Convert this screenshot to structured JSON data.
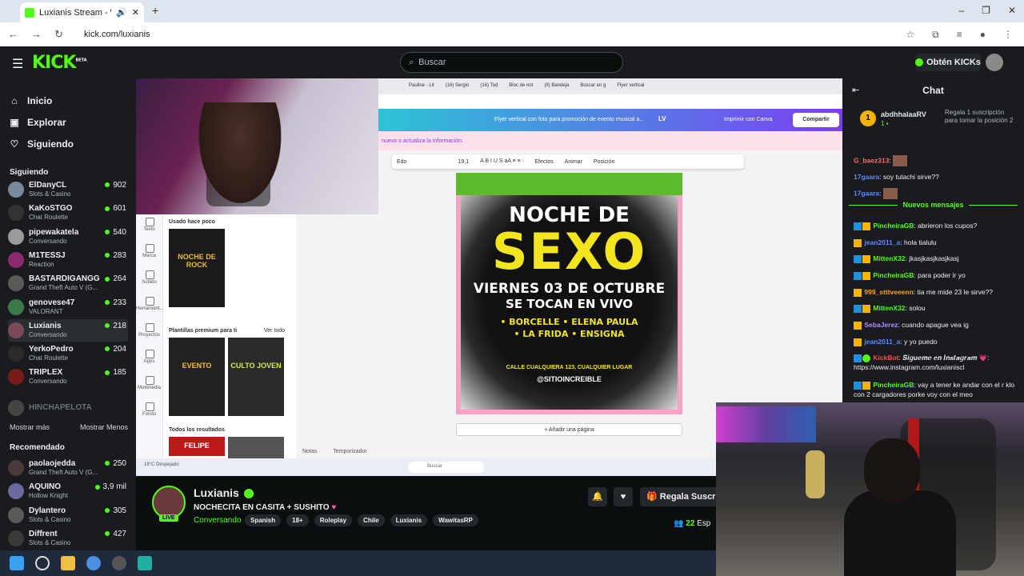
{
  "browser": {
    "tab_title": "Luxianis Stream - Watch Liv",
    "url": "kick.com/luxianis"
  },
  "header": {
    "logo": "KICK",
    "logo_beta": "BETA",
    "search_placeholder": "Buscar",
    "get_kicks": "Obtén KICKs"
  },
  "sidebar": {
    "nav": [
      {
        "label": "Inicio",
        "icon": "home-icon"
      },
      {
        "label": "Explorar",
        "icon": "compass-icon"
      },
      {
        "label": "Siguiendo",
        "icon": "heart-icon"
      }
    ],
    "following_title": "Siguiendo",
    "following": [
      {
        "name": "ElDanyCL",
        "category": "Slots & Casino",
        "viewers": "902",
        "color": "#7a8a9a"
      },
      {
        "name": "KaKoSTGO",
        "category": "Chat Roulette",
        "viewers": "601",
        "color": "#333333"
      },
      {
        "name": "pipewakatela",
        "category": "Conversando",
        "viewers": "540",
        "color": "#9a9a9a"
      },
      {
        "name": "M1TESSJ",
        "category": "Reaction",
        "viewers": "283",
        "color": "#8a2a6a"
      },
      {
        "name": "BASTARDIGANGG",
        "category": "Grand Theft Auto V (G...",
        "viewers": "264",
        "color": "#5a5a5a"
      },
      {
        "name": "genovese47",
        "category": "VALORANT",
        "viewers": "233",
        "color": "#3a7a4a"
      },
      {
        "name": "Luxianis",
        "category": "Conversando",
        "viewers": "218",
        "color": "#7a4a5a"
      },
      {
        "name": "YerkoPedro",
        "category": "Chat Roulette",
        "viewers": "204",
        "color": "#2a2a2a"
      },
      {
        "name": "TRIPLEX",
        "category": "Conversando",
        "viewers": "185",
        "color": "#7a1a1a"
      }
    ],
    "offline": "HINCHAPELOTA",
    "show_more": "Mostrar más",
    "show_less": "Mostrar Menos",
    "recommended_title": "Recomendado",
    "recommended": [
      {
        "name": "paolaojedda",
        "category": "Grand Theft Auto V (G...",
        "viewers": "250",
        "color": "#4a3a3a"
      },
      {
        "name": "AQUINO",
        "category": "Hollow Knight",
        "viewers": "3,9 mil",
        "color": "#6a6aa0"
      },
      {
        "name": "Dylantero",
        "category": "Slots & Casino",
        "viewers": "305",
        "color": "#5a5a5a"
      },
      {
        "name": "Diffrent",
        "category": "Slots & Casino",
        "viewers": "427",
        "color": "#3a3a3a"
      }
    ]
  },
  "video": {
    "canva_tabs": [
      "Pauline - Lit",
      "(16) Sergio",
      "(16) Tod",
      "Bloc de not",
      "(9) Bandeja",
      "Buscar en g",
      "Flyer vertical"
    ],
    "canva_title": "Flyer vertical con foto para promoción de evento musical a...",
    "canva_lv": "LV",
    "canva_print": "Imprimir con Canva",
    "canva_share": "Compartir",
    "canva_notice": "nuevo o actualiza la información.",
    "toolbar_font": "Edo",
    "toolbar_size": "19,1",
    "toolbar_effects": "Efectos",
    "toolbar_animate": "Animar",
    "toolbar_position": "Posición",
    "panel_recent": "Usado hace poco",
    "panel_premium": "Plantillas premium para ti",
    "panel_see_all": "Ver todo",
    "panel_all_results": "Todos los resultados",
    "side_icons": [
      "Texto",
      "Marca",
      "Subido",
      "Herramient...",
      "Proyectos",
      "Apps",
      "Multimedia",
      "Fondo"
    ],
    "thumb1": "NOCHE DE ROCK",
    "thumb2": "EVENTO",
    "thumb3": "CULTO JOVEN",
    "thumb4": "FELIPE",
    "poster_line1": "NOCHE DE",
    "poster_line2": "SEXO",
    "poster_line3": "VIERNES 03 DE OCTUBRE",
    "poster_line4": "SE TOCAN EN VIVO",
    "poster_line5": "• BORCELLE • ELENA PAULA",
    "poster_line6": "• LA FRIDA • ENSIGNA",
    "poster_line7": "CALLE CUALQUIERA 123, CUALQUIER LUGAR",
    "poster_line8": "@SITIOINCREIBLE",
    "add_page": "+ Añadir una página",
    "notes": "Notas",
    "timer": "Temporizador",
    "weather": "18°C Despejado",
    "taskbar_search": "Buscar"
  },
  "stream": {
    "name": "Luxianis",
    "live": "LIVE",
    "title": "NOCHECITA EN CASITA + SUSHITO",
    "category": "Conversando",
    "tags": [
      "Spanish",
      "18+",
      "Roleplay",
      "Chile",
      "Luxianis",
      "WawitasRP"
    ],
    "gift": "Regala Suscrip",
    "viewers": "22",
    "viewers_suffix": "Esp"
  },
  "chat": {
    "title": "Chat",
    "pinned": {
      "rank": "1",
      "user": "abdhhalaaRV",
      "subs": "1",
      "gift": "Regala 1 suscripción para tomar la posición 2"
    },
    "messages_before": [
      {
        "user": "G_baez313",
        "text": "",
        "color": "#ff6b6b"
      },
      {
        "user": "17gaara",
        "text": "soy tulachi sirve??",
        "color": "#5b8cff"
      },
      {
        "user": "17gaara",
        "text": "",
        "color": "#5b8cff"
      }
    ],
    "new_messages": "Nuevos mensajes",
    "messages": [
      {
        "user": "PincheiraGB",
        "text": "abrieron los cupos?",
        "color": "#53fc18"
      },
      {
        "user": "jean2011_a",
        "text": "hola tialulu",
        "color": "#5b8cff"
      },
      {
        "user": "MittenX32",
        "text": "jkasjkasjkasjkasj",
        "color": "#53fc18"
      },
      {
        "user": "PincheiraGB",
        "text": "para poder ir yo",
        "color": "#53fc18"
      },
      {
        "user": "999_stttveeenn",
        "text": "tia me mide 23 le sirve??",
        "color": "#ff9f1a"
      },
      {
        "user": "MittenX32",
        "text": "solou",
        "color": "#53fc18"
      },
      {
        "user": "SebaJerez",
        "text": "cuando apague vea ig",
        "color": "#b78cff"
      },
      {
        "user": "jean2011_a",
        "text": "y yo puedo",
        "color": "#5b8cff"
      },
      {
        "user": "KickBot",
        "text": "𝑺𝒊𝒈𝒖𝒆𝒎𝒆 𝒆𝒏 𝑰𝒏𝒔𝒕𝒂𝒈𝒓𝒂𝒎 💗: https://www.instagram.com/luxianiscl",
        "color": "#ff4d4d"
      },
      {
        "user": "PincheiraGB",
        "text": "vay a tener ke andar con el r klo con 2 cargadores porke voy con el meo",
        "color": "#53fc18"
      }
    ]
  }
}
